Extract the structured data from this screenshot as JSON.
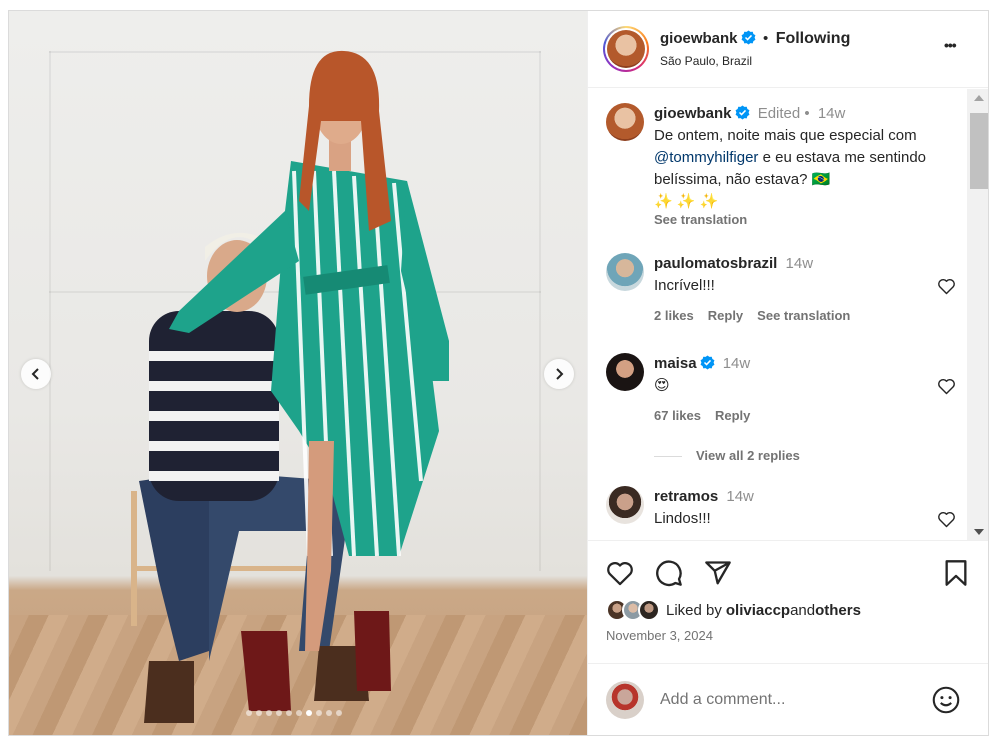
{
  "post": {
    "author": "gioewbank",
    "location": "São Paulo, Brazil",
    "follow_status": "Following",
    "separator": "•",
    "more_label": "•••"
  },
  "caption": {
    "author": "gioewbank",
    "edited": "Edited",
    "dot": "•",
    "time": "14w",
    "text_before": "De ontem, noite mais que especial com ",
    "mention": "@tommyhilfiger",
    "text_after": " e eu estava me sentindo belíssima, não estava? 🇧🇷",
    "sparkles": "✨ ✨ ✨",
    "see_translation": "See translation"
  },
  "comments": [
    {
      "author": "paulomatosbrazil",
      "time": "14w",
      "text": "Incrível!!!",
      "likes": "2 likes",
      "reply": "Reply",
      "translate": "See translation"
    },
    {
      "author": "maisa",
      "time": "14w",
      "text": "😍",
      "likes": "67 likes",
      "reply": "Reply",
      "replies_link": "View all 2 replies"
    },
    {
      "author": "retramos",
      "time": "14w",
      "text": "Lindos!!!"
    }
  ],
  "likes": {
    "prefix": "Liked by ",
    "user": "oliviaccp",
    "middle": " and ",
    "others": "others"
  },
  "date": "November 3, 2024",
  "comment_input": {
    "placeholder": "Add a comment..."
  },
  "carousel": {
    "total": 10,
    "active_index": 6
  },
  "colors": {
    "verified": "#0095f6",
    "link": "#00376b",
    "muted": "#737373",
    "border": "#dbdbdb"
  },
  "icons": [
    "chevron-left-icon",
    "chevron-right-icon",
    "verified-icon",
    "more-icon",
    "heart-icon",
    "comment-icon",
    "share-icon",
    "bookmark-icon",
    "emoji-icon"
  ]
}
